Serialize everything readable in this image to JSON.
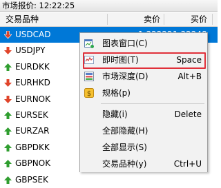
{
  "window": {
    "title": "市场报价: 12:22:25"
  },
  "header": {
    "col_symbol": "交易品种",
    "col_bid": "卖价",
    "col_ask": "买价"
  },
  "symbols": [
    {
      "name": "USDCAD",
      "dir": "down",
      "selected": true,
      "bid": "1.32222",
      "ask": "1.32248"
    },
    {
      "name": "USDJPY",
      "dir": "down"
    },
    {
      "name": "EURDKK",
      "dir": "up"
    },
    {
      "name": "EURHKD",
      "dir": "down"
    },
    {
      "name": "EURNOK",
      "dir": "down"
    },
    {
      "name": "EURSEK",
      "dir": "up"
    },
    {
      "name": "EURZAR",
      "dir": "up"
    },
    {
      "name": "GBPDKK",
      "dir": "up"
    },
    {
      "name": "GBPNOK",
      "dir": "up"
    },
    {
      "name": "GBPSEK",
      "dir": "up"
    }
  ],
  "colors": {
    "up": "#2f9e2f",
    "down": "#e0442a",
    "selection": "#0078d7",
    "highlight_border": "#e0303a"
  },
  "context_menu": {
    "items": [
      {
        "label": "图表窗口(C)",
        "shortcut": "",
        "icon": "chart-window-icon"
      },
      {
        "label": "即时图(T)",
        "shortcut": "Space",
        "icon": "tick-chart-icon",
        "highlighted": true
      },
      {
        "label": "市场深度(D)",
        "shortcut": "Alt+B",
        "icon": "market-depth-icon"
      },
      {
        "label": "规格(p)",
        "shortcut": "",
        "icon": "specification-icon"
      },
      {
        "label": "隐藏(i)",
        "shortcut": "Delete",
        "icon": ""
      },
      {
        "label": "全部隐藏(H)",
        "shortcut": "",
        "icon": ""
      },
      {
        "label": "全部显示(S)",
        "shortcut": "",
        "icon": ""
      },
      {
        "label": "交易品种(y)",
        "shortcut": "Ctrl+U",
        "icon": ""
      }
    ]
  }
}
